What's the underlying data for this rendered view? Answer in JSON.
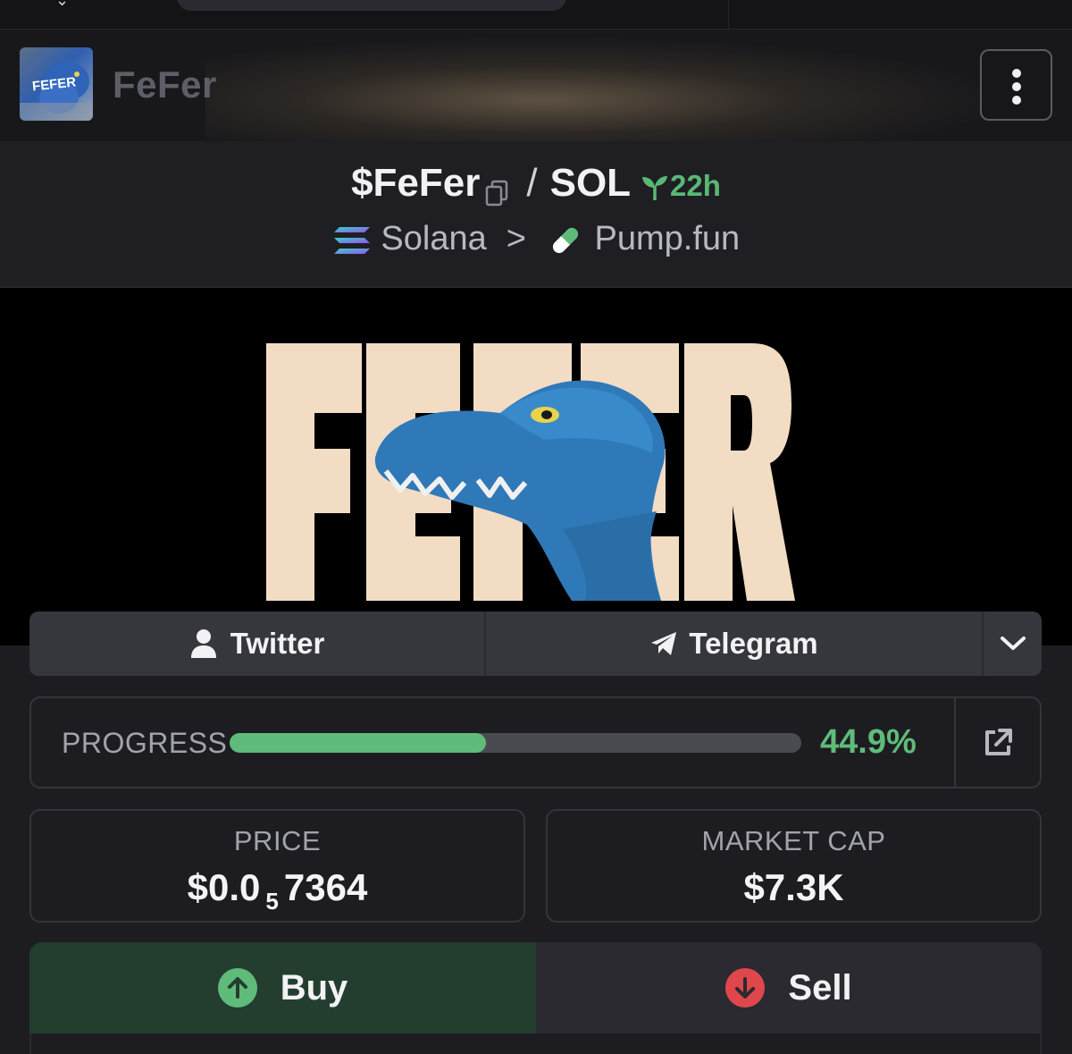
{
  "header": {
    "token_name": "FeFer",
    "avatar_text": "FEFER"
  },
  "pair": {
    "base": "$FeFer",
    "slash": "/",
    "quote": "SOL",
    "age": "22h",
    "chain": "Solana",
    "separator": ">",
    "dex": "Pump.fun"
  },
  "banner": {
    "title_text": "FEFER"
  },
  "social": {
    "twitter_label": "Twitter",
    "telegram_label": "Telegram"
  },
  "progress": {
    "label": "PROGRESS",
    "value_text": "44.9%",
    "fraction": 0.449
  },
  "stats": {
    "price_label": "PRICE",
    "price_prefix": "$0.0",
    "price_zeros": "5",
    "price_digits": "7364",
    "mcap_label": "MARKET CAP",
    "mcap_value": "$7.3K"
  },
  "trade": {
    "buy_label": "Buy",
    "sell_label": "Sell"
  },
  "colors": {
    "accent_green": "#5fbb7a",
    "sell_red": "#e0474c",
    "buy_bg": "#233d2f"
  }
}
